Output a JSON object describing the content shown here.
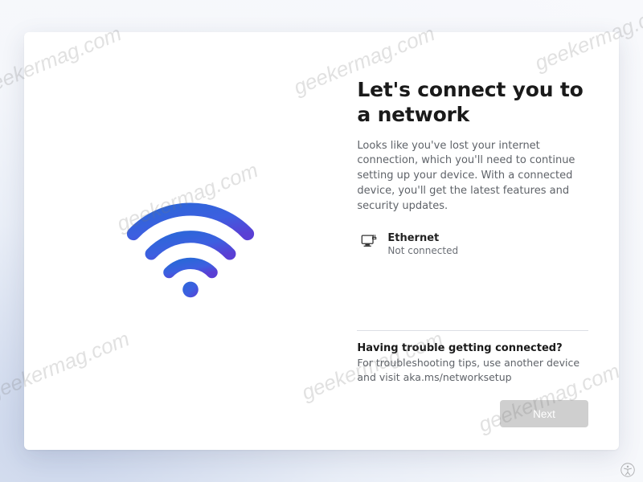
{
  "title": "Let's connect you to a network",
  "description": "Looks like you've lost your internet connection, which you'll need to continue setting up your device. With a connected device, you'll get the latest features and security updates.",
  "network": {
    "name": "Ethernet",
    "status": "Not connected"
  },
  "help": {
    "title": "Having trouble getting connected?",
    "description": "For troubleshooting tips, use another device and visit aka.ms/networksetup"
  },
  "buttons": {
    "next": "Next"
  },
  "watermark": "geekermag.com"
}
